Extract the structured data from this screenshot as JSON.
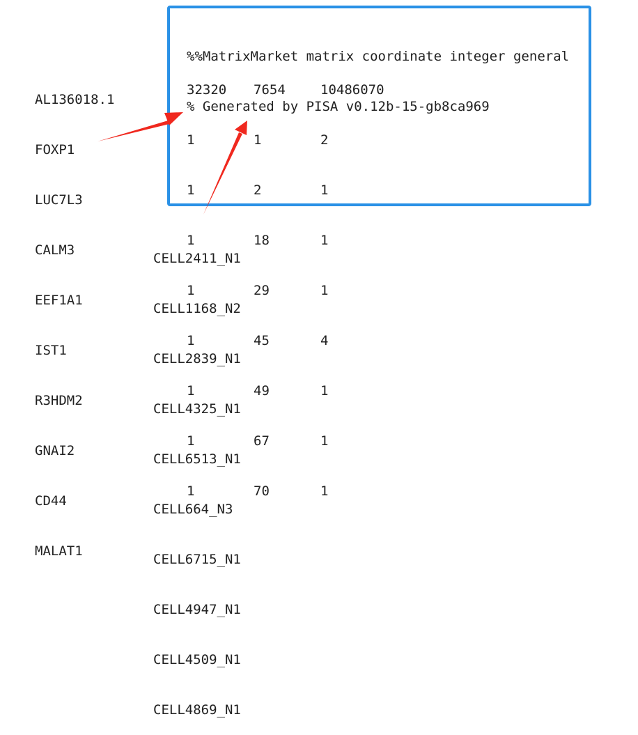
{
  "matrix": {
    "header_lines": [
      "%%MatrixMarket matrix coordinate integer general",
      "% Generated by PISA v0.12b-15-gb8ca969"
    ],
    "dimensions": [
      "32320",
      "7654",
      "10486070"
    ],
    "rows": [
      [
        "1",
        "1",
        "2"
      ],
      [
        "1",
        "2",
        "1"
      ],
      [
        "1",
        "18",
        "1"
      ],
      [
        "1",
        "29",
        "1"
      ],
      [
        "1",
        "45",
        "4"
      ],
      [
        "1",
        "49",
        "1"
      ],
      [
        "1",
        "67",
        "1"
      ],
      [
        "1",
        "70",
        "1"
      ]
    ]
  },
  "genes": [
    "AL136018.1",
    "FOXP1",
    "LUC7L3",
    "CALM3",
    "EEF1A1",
    "IST1",
    "R3HDM2",
    "GNAI2",
    "CD44",
    "MALAT1"
  ],
  "cells": [
    "CELL2411_N1",
    "CELL1168_N2",
    "CELL2839_N1",
    "CELL4325_N1",
    "CELL6513_N1",
    "CELL664_N3",
    "CELL6715_N1",
    "CELL4947_N1",
    "CELL4509_N1",
    "CELL4869_N1"
  ],
  "colors": {
    "box_border": "#2a91e6",
    "arrow": "#f0281e",
    "text": "#222222"
  }
}
